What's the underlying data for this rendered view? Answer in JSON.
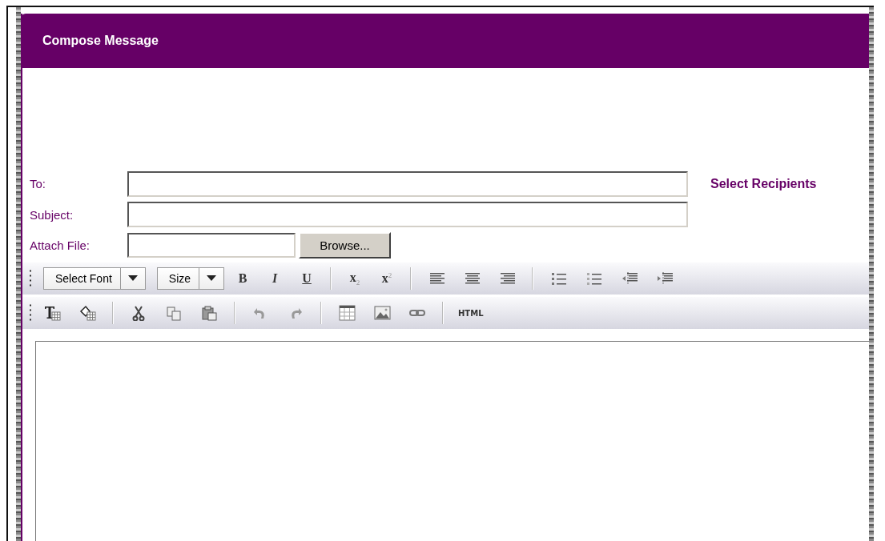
{
  "panel": {
    "title": "Compose Message"
  },
  "form": {
    "to_label": "To:",
    "subject_label": "Subject:",
    "attach_label": "Attach File:",
    "browse_button": "Browse...",
    "select_recipients_link": "Select Recipients"
  },
  "toolbar_1": [
    {
      "kind": "grip"
    },
    {
      "kind": "dropdown",
      "label": "Select Font"
    },
    {
      "kind": "dropdown",
      "label": "Size"
    },
    {
      "kind": "glyph",
      "label": "B"
    },
    {
      "kind": "glyph",
      "label": "I"
    },
    {
      "kind": "glyph",
      "label": "U"
    },
    {
      "kind": "separator"
    },
    {
      "kind": "glyph",
      "label": "x$_{2}$"
    },
    {
      "kind": "glyph",
      "label": "x$^{2}$"
    },
    {
      "kind": "separator"
    },
    {
      "kind": "icon"
    },
    {
      "kind": "icon"
    },
    {
      "kind": "icon"
    },
    {
      "kind": "separator"
    },
    {
      "kind": "icon"
    },
    {
      "kind": "icon"
    },
    {
      "kind": "icon"
    },
    {
      "kind": "icon"
    }
  ],
  "toolbar_2": [
    {
      "kind": "grip"
    },
    {
      "kind": "icon"
    },
    {
      "kind": "icon"
    },
    {
      "kind": "separator"
    },
    {
      "kind": "icon"
    },
    {
      "kind": "icon"
    },
    {
      "kind": "icon"
    },
    {
      "kind": "separator"
    },
    {
      "kind": "icon"
    },
    {
      "kind": "icon"
    },
    {
      "kind": "separator"
    },
    {
      "kind": "icon"
    },
    {
      "kind": "icon"
    },
    {
      "kind": "icon"
    },
    {
      "kind": "separator"
    },
    {
      "kind": "glyph",
      "label": "HTML"
    }
  ]
}
